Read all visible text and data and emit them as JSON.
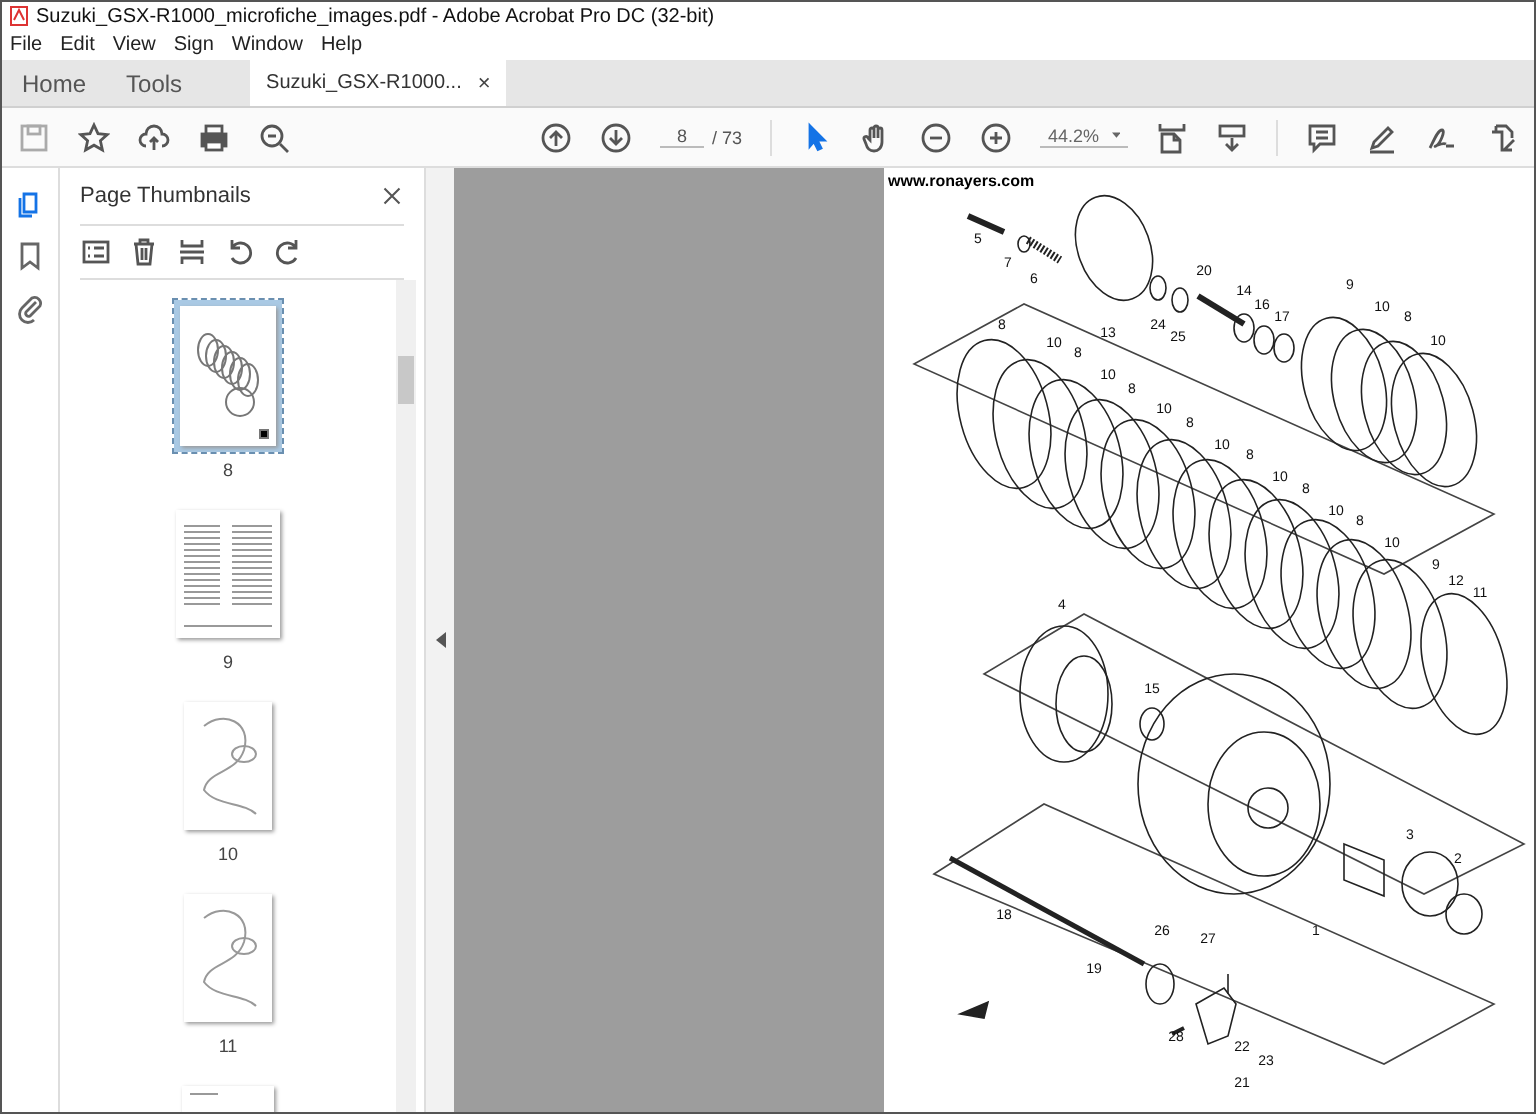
{
  "window": {
    "title": "Suzuki_GSX-R1000_microfiche_images.pdf - Adobe Acrobat Pro DC (32-bit)"
  },
  "menu": [
    "File",
    "Edit",
    "View",
    "Sign",
    "Window",
    "Help"
  ],
  "tabs": [
    {
      "label": "Home",
      "selected": false,
      "closable": false
    },
    {
      "label": "Tools",
      "selected": false,
      "closable": false
    },
    {
      "label": "Suzuki_GSX-R1000...",
      "selected": true,
      "closable": true,
      "close": "×"
    }
  ],
  "toolbar": {
    "page": "8",
    "page_total": "/ 73",
    "zoom": "44.2%"
  },
  "side_rail": [
    {
      "kind": "thumbnails",
      "selected": true
    },
    {
      "kind": "bookmarks",
      "selected": false
    },
    {
      "kind": "attachments",
      "selected": false
    }
  ],
  "panel": {
    "title": "Page Thumbnails",
    "thumbnails": [
      {
        "label": "8",
        "kind": "diagram",
        "selected": true
      },
      {
        "label": "9",
        "kind": "list",
        "selected": false
      },
      {
        "label": "10",
        "kind": "sketch",
        "selected": false
      },
      {
        "label": "11",
        "kind": "sketch",
        "selected": false
      },
      {
        "kind": "partial",
        "selected": false
      }
    ]
  },
  "document": {
    "site": "www.ronayers.com",
    "callouts": [
      "5",
      "7",
      "6",
      "13",
      "20",
      "24",
      "25",
      "14",
      "16",
      "17",
      "9",
      "10",
      "8",
      "10",
      "8",
      "10",
      "8",
      "10",
      "8",
      "10",
      "8",
      "10",
      "8",
      "10",
      "8",
      "10",
      "8",
      "10",
      "9",
      "12",
      "11",
      "4",
      "15",
      "3",
      "2",
      "1",
      "18",
      "27",
      "26",
      "19",
      "28",
      "22",
      "23",
      "21"
    ]
  }
}
